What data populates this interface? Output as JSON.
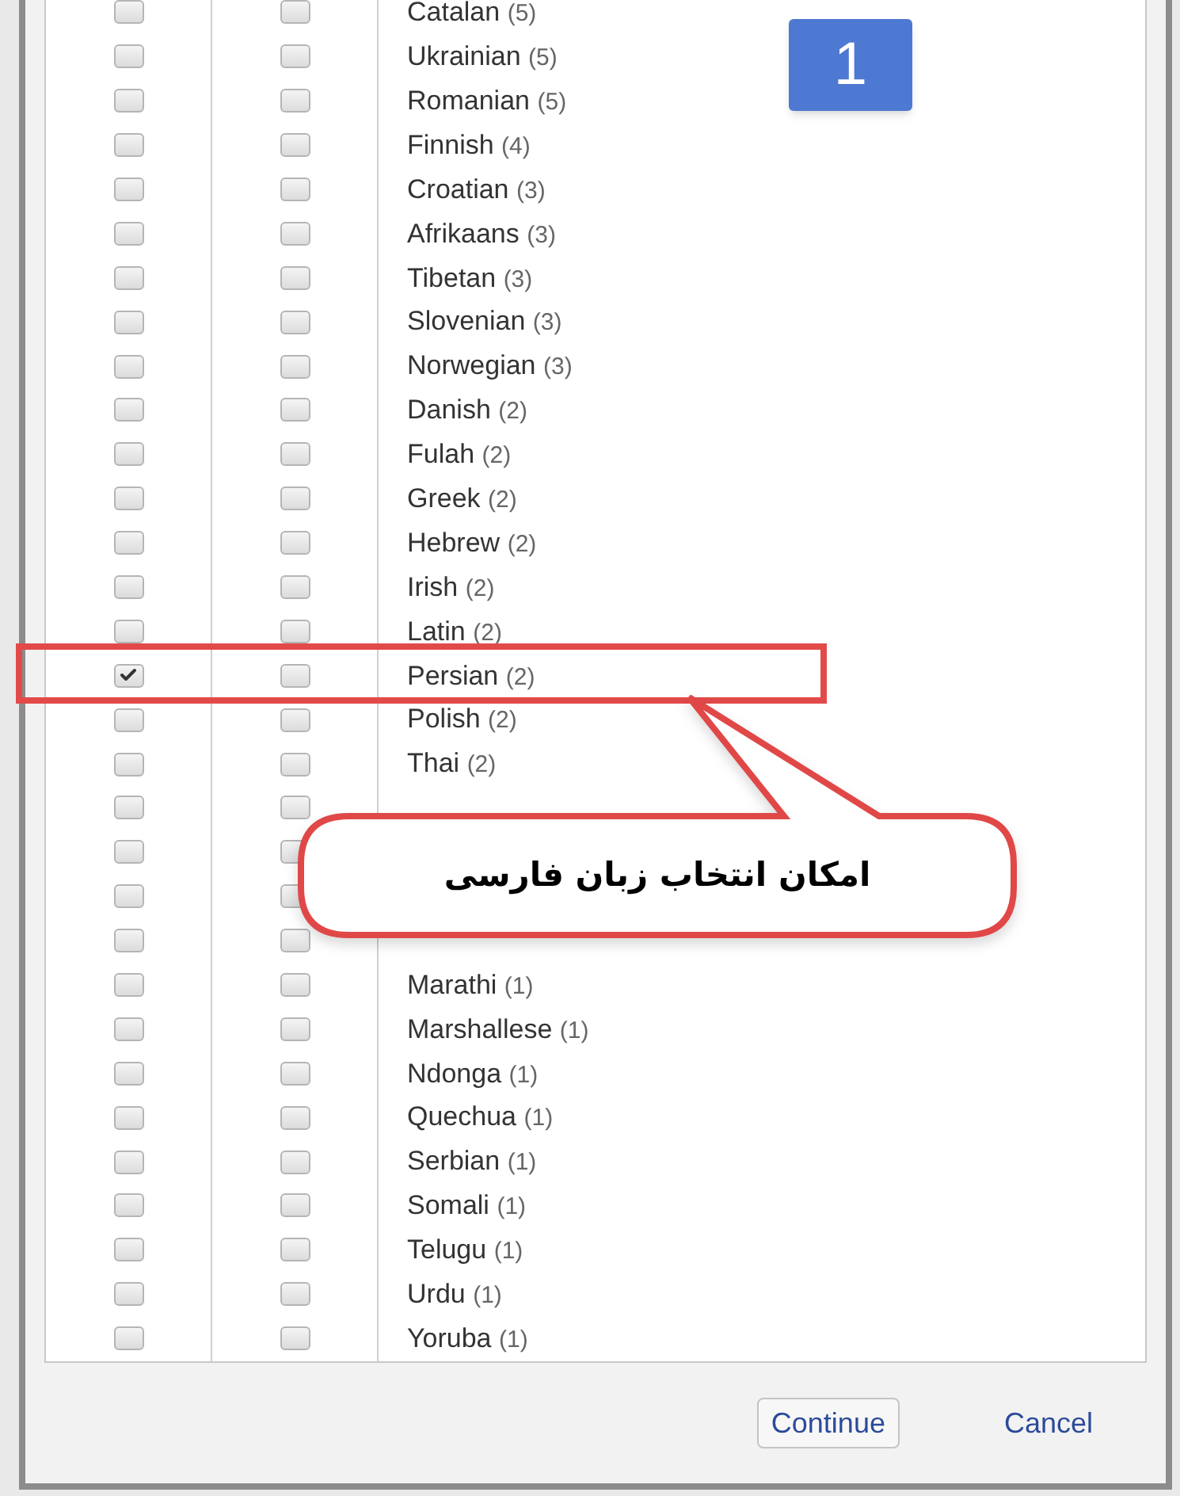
{
  "languages": [
    {
      "name": "Catalan",
      "count": "(5)",
      "checked_1": false,
      "checked_2": false
    },
    {
      "name": "Ukrainian",
      "count": "(5)",
      "checked_1": false,
      "checked_2": false
    },
    {
      "name": "Romanian",
      "count": "(5)",
      "checked_1": false,
      "checked_2": false
    },
    {
      "name": "Finnish",
      "count": "(4)",
      "checked_1": false,
      "checked_2": false
    },
    {
      "name": "Croatian",
      "count": "(3)",
      "checked_1": false,
      "checked_2": false
    },
    {
      "name": "Afrikaans",
      "count": "(3)",
      "checked_1": false,
      "checked_2": false
    },
    {
      "name": "Tibetan",
      "count": "(3)",
      "checked_1": false,
      "checked_2": false
    },
    {
      "name": "Slovenian",
      "count": "(3)",
      "checked_1": false,
      "checked_2": false
    },
    {
      "name": "Norwegian",
      "count": "(3)",
      "checked_1": false,
      "checked_2": false
    },
    {
      "name": "Danish",
      "count": "(2)",
      "checked_1": false,
      "checked_2": false
    },
    {
      "name": "Fulah",
      "count": "(2)",
      "checked_1": false,
      "checked_2": false
    },
    {
      "name": "Greek",
      "count": "(2)",
      "checked_1": false,
      "checked_2": false
    },
    {
      "name": "Hebrew",
      "count": "(2)",
      "checked_1": false,
      "checked_2": false
    },
    {
      "name": "Irish",
      "count": "(2)",
      "checked_1": false,
      "checked_2": false
    },
    {
      "name": "Latin",
      "count": "(2)",
      "checked_1": false,
      "checked_2": false
    },
    {
      "name": "Persian",
      "count": "(2)",
      "checked_1": true,
      "checked_2": false
    },
    {
      "name": "Polish",
      "count": "(2)",
      "checked_1": false,
      "checked_2": false
    },
    {
      "name": "Thai",
      "count": "(2)",
      "checked_1": false,
      "checked_2": false
    },
    {
      "checked_1": false,
      "checked_2": false
    },
    {
      "checked_1": false,
      "checked_2": false
    },
    {
      "checked_1": false,
      "checked_2": false
    },
    {
      "checked_1": false,
      "checked_2": false
    },
    {
      "name": "Marathi",
      "count": "(1)",
      "checked_1": false,
      "checked_2": false
    },
    {
      "name": "Marshallese",
      "count": "(1)",
      "checked_1": false,
      "checked_2": false
    },
    {
      "name": "Ndonga",
      "count": "(1)",
      "checked_1": false,
      "checked_2": false
    },
    {
      "name": "Quechua",
      "count": "(1)",
      "checked_1": false,
      "checked_2": false
    },
    {
      "name": "Serbian",
      "count": "(1)",
      "checked_1": false,
      "checked_2": false
    },
    {
      "name": "Somali",
      "count": "(1)",
      "checked_1": false,
      "checked_2": false
    },
    {
      "name": "Telugu",
      "count": "(1)",
      "checked_1": false,
      "checked_2": false
    },
    {
      "name": "Urdu",
      "count": "(1)",
      "checked_1": false,
      "checked_2": false
    },
    {
      "name": "Yoruba",
      "count": "(1)",
      "checked_1": false,
      "checked_2": false
    }
  ],
  "buttons": {
    "continue": "Continue",
    "cancel": "Cancel"
  },
  "annotations": {
    "step_badge": "1",
    "callout": "امکان انتخاب زبان فارسی"
  }
}
